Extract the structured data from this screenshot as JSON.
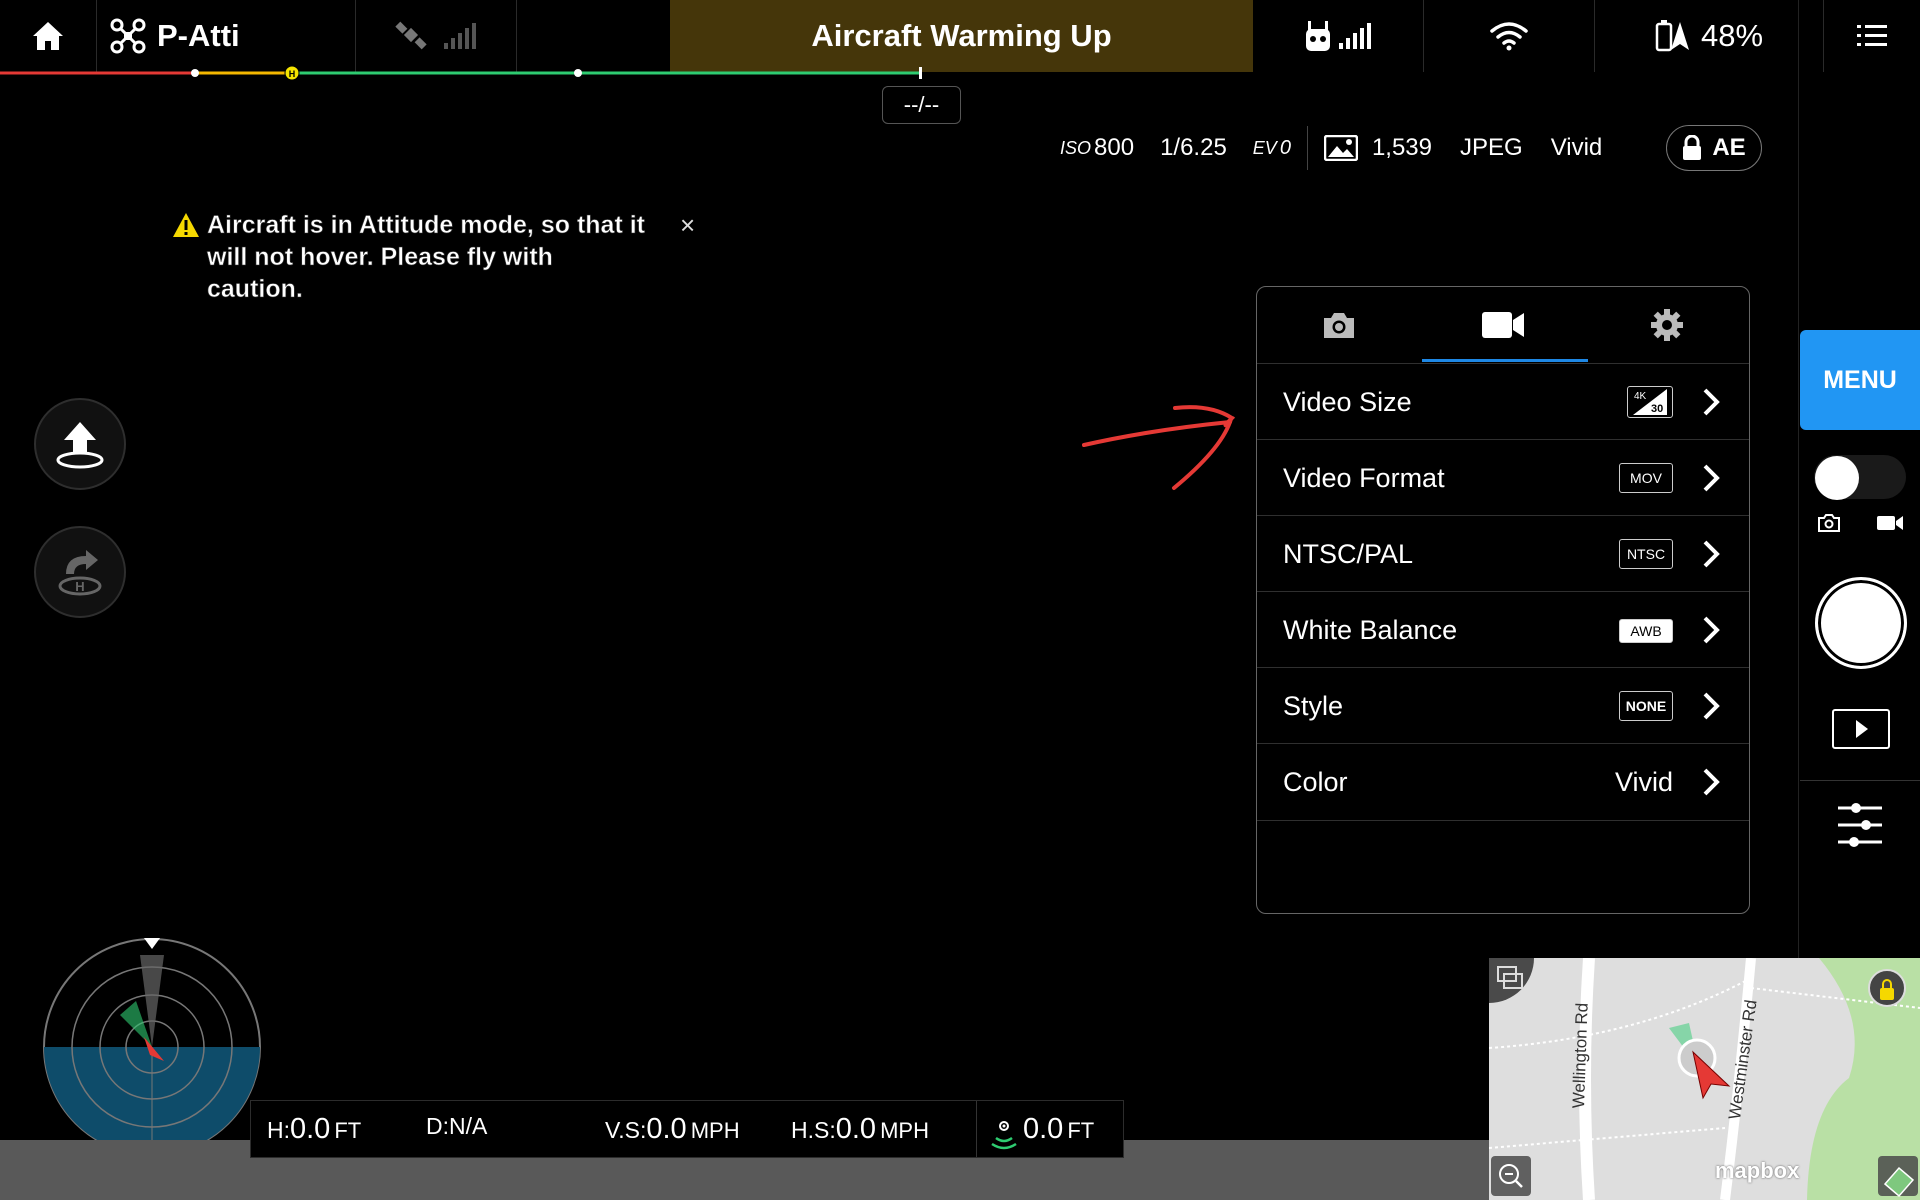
{
  "topbar": {
    "flight_mode": "P-Atti",
    "status": "Aircraft Warming Up",
    "battery": "48%",
    "colors": {
      "status_bg": "#45360a"
    }
  },
  "timer": "--/--",
  "camera_params": {
    "iso_label": "ISO",
    "iso": "800",
    "shutter": "1/6.25",
    "ev_label": "EV",
    "ev": "0",
    "photo_count": "1,539",
    "format": "JPEG",
    "style": "Vivid",
    "ae_label": "AE"
  },
  "warning": {
    "text": "Aircraft is in Attitude mode, so that it will not hover. Please fly with caution.",
    "close": "×"
  },
  "settings_panel": {
    "tabs": [
      {
        "icon": "camera-icon",
        "active": false
      },
      {
        "icon": "video-camera-icon",
        "active": true
      },
      {
        "icon": "gear-icon",
        "active": false
      }
    ],
    "rows": [
      {
        "label": "Video Size",
        "badge": "4K 30"
      },
      {
        "label": "Video Format",
        "badge": "MOV"
      },
      {
        "label": "NTSC/PAL",
        "badge": "NTSC"
      },
      {
        "label": "White Balance",
        "badge": "AWB"
      },
      {
        "label": "Style",
        "badge": "NONE"
      },
      {
        "label": "Color",
        "value": "Vivid"
      }
    ],
    "badge_4k_top": "4K",
    "badge_4k_bottom": "30",
    "accent": "#1e88e5"
  },
  "rail": {
    "menu_label": "MENU",
    "accent": "#2196f3"
  },
  "telemetry": {
    "h_label": "H:",
    "h_value": "0.0",
    "h_unit": "FT",
    "d_label": "D:",
    "d_value": "N/A",
    "vs_label": "V.S:",
    "vs_value": "0.0",
    "vs_unit": "MPH",
    "hs_label": "H.S:",
    "hs_value": "0.0",
    "hs_unit": "MPH",
    "vps_value": "0.0",
    "vps_unit": "FT"
  },
  "map": {
    "street_1": "Wellington Rd",
    "street_2": "Westminster Rd",
    "logo": "mapbox"
  }
}
